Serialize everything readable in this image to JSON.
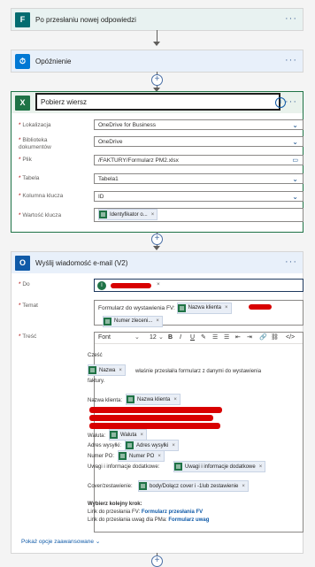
{
  "step1": {
    "title": "Po przesłaniu nowej odpowiedzi",
    "dots": "···"
  },
  "step2": {
    "title": "Opóźnienie",
    "dots": "···"
  },
  "step3": {
    "title": "Pobierz wiersz",
    "info_icon": "info-icon",
    "dots": "···",
    "fields": [
      {
        "label": "Lokalizacja",
        "value": "OneDrive for Business"
      },
      {
        "label": "Biblioteka dokumentów",
        "value": "OneDrive"
      },
      {
        "label": "Plik",
        "value": "/FAKTURY/Formularz PM2.xlsx"
      },
      {
        "label": "Tabela",
        "value": "Tabela1"
      },
      {
        "label": "Kolumna klucza",
        "value": "ID"
      },
      {
        "label": "Wartość klucza",
        "token": "Identyfikator o...",
        "close": "×"
      }
    ]
  },
  "step4": {
    "title": "Wyślij wiadomość e-mail (V2)",
    "dots": "···",
    "do_label": "Do",
    "do_avatar": "I",
    "temat_label": "Temat",
    "temat_text": "Formularz do wystawienia FV:",
    "temat_token1": "Nazwa klienta",
    "temat_token2": "Numer zleceni...",
    "tresc_label": "Treść",
    "toolbar": {
      "font": "Font",
      "size": "12",
      "bold": "B",
      "italic": "I",
      "underline": "U"
    },
    "body": {
      "greeting": "Cześć",
      "nazwa_token": "Nazwa",
      "line1": "właśnie przesłał/a formularz z danymi do wystawienia",
      "line1b": "faktury.",
      "nazwa_klienta_label": "Nazwa klienta:",
      "nazwa_klienta_token": "Nazwa klienta",
      "waluta_label": "Waluta:",
      "waluta_token": "Waluta",
      "adres_label": "Adres wysyłki:",
      "adres_token": "Adres wysyłki",
      "numer_po_label": "Numer PO:",
      "numer_po_token": "Numer PO",
      "uwagi_label": "Uwagi i informacje dodatkowe:",
      "uwagi_token": "Uwagi i informacje dodatkowe",
      "cover_label": "Cover/zestawienie:",
      "cover_token": "body/Dołącz cover i -1lub zestawienie",
      "next_step": "Wybierz kolejny krok:",
      "link1_prefix": "Link do przesłania FV:",
      "link1": "Formularz przesłania FV",
      "link2_prefix": "Link do przesłania uwag dla PMa:",
      "link2": "Formularz uwag"
    },
    "advanced": "Pokaż opcje zaawansowane"
  },
  "colors": {
    "forms": "#036c70",
    "delay": "#0078d4",
    "excel": "#1f7346",
    "outlook": "#0f5aa8",
    "redact": "#d80000"
  }
}
